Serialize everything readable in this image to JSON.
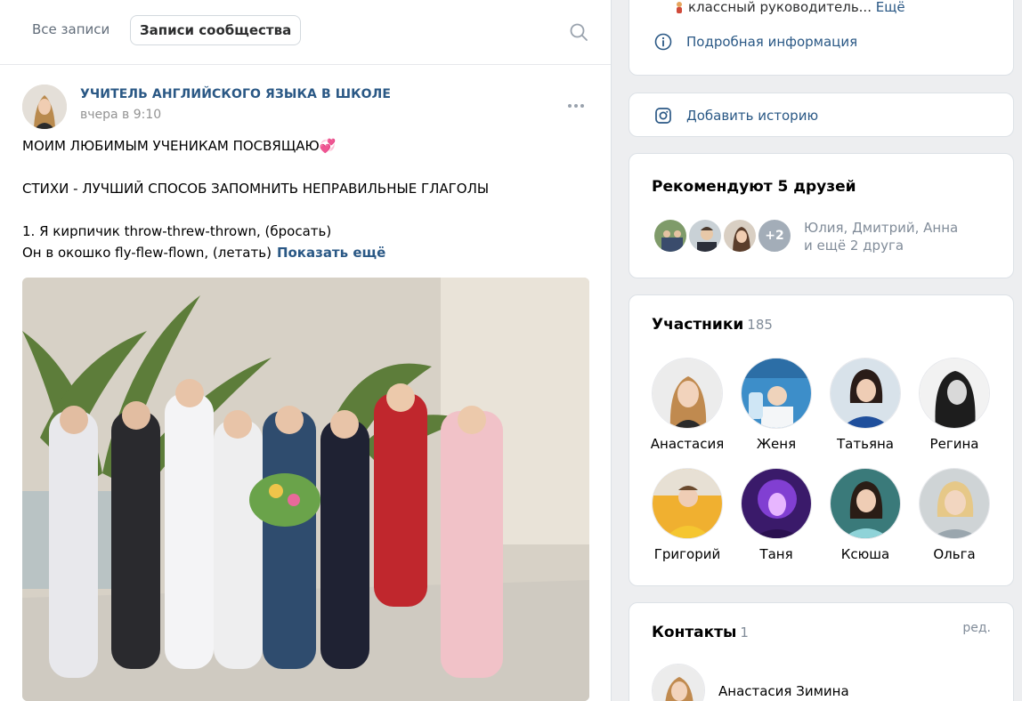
{
  "tabs": {
    "all": "Все записи",
    "community": "Записи сообщества"
  },
  "post": {
    "author": "УЧИТЕЛЬ АНГЛИЙСКОГО ЯЗЫКА В ШКОЛЕ",
    "date": "вчера в 9:10",
    "lines": [
      "МОИМ ЛЮБИМЫМ УЧЕНИКАМ ПОСВЯЩАЮ💞",
      "СТИХИ - ЛУЧШИЙ СПОСОБ ЗАПОМНИТЬ НЕПРАВИЛЬНЫЕ ГЛАГОЛЫ",
      "1. Я кирпичик throw-threw-thrown, (бросать)",
      "Он в окошко fly-flew-flown, (летать)"
    ],
    "show_more": "Показать ещё"
  },
  "info": {
    "teacher_text": "классный руководитель...",
    "teacher_more": "Ещё",
    "details_label": "Подробная информация"
  },
  "story": {
    "label": "Добавить историю"
  },
  "friends": {
    "title": "Рекомендуют 5 друзей",
    "plus": "+2",
    "names_line1": "Юлия, Дмитрий, Анна",
    "names_line2": "и ещё 2 друга"
  },
  "members": {
    "title": "Участники",
    "count": "185",
    "list": [
      {
        "name": "Анастасия"
      },
      {
        "name": "Женя"
      },
      {
        "name": "Татьяна"
      },
      {
        "name": "Регина"
      },
      {
        "name": "Григорий"
      },
      {
        "name": "Таня"
      },
      {
        "name": "Ксюша"
      },
      {
        "name": "Ольга"
      }
    ]
  },
  "contacts": {
    "title": "Контакты",
    "count": "1",
    "edit": "ред.",
    "name": "Анастасия Зимина"
  },
  "colors": {
    "link": "#2a5885",
    "muted": "#818c99",
    "background": "#edeef0"
  }
}
